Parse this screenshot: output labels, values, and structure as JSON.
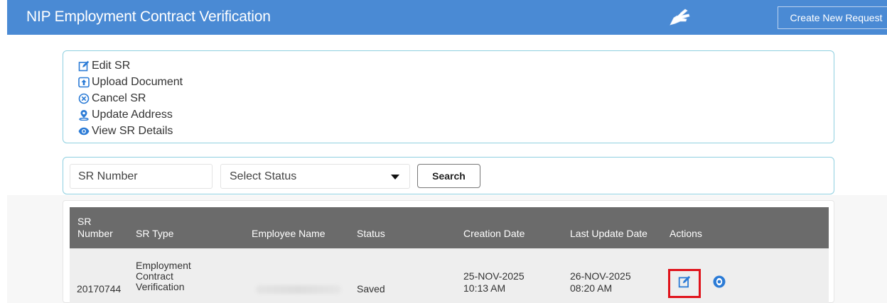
{
  "header": {
    "title": "NIP Employment Contract Verification",
    "create_button_label": "Create New Request",
    "hand_icon": "pointing-hand-icon",
    "bg_color": "#4a8ad4"
  },
  "legend": {
    "items": [
      {
        "label": "Edit SR",
        "icon": "edit-icon"
      },
      {
        "label": "Upload Document",
        "icon": "upload-icon"
      },
      {
        "label": "Cancel SR",
        "icon": "cancel-circle-icon"
      },
      {
        "label": "Update Address",
        "icon": "location-pin-icon"
      },
      {
        "label": "View SR Details",
        "icon": "eye-icon"
      }
    ]
  },
  "search": {
    "sr_number_placeholder": "SR Number",
    "status_selected": "Select Status",
    "search_button_label": "Search"
  },
  "table": {
    "columns": [
      "SR\nNumber",
      "SR Type",
      "Employee Name",
      "Status",
      "Creation Date",
      "Last Update Date",
      "Actions"
    ],
    "rows": [
      {
        "sr_number": "20170744",
        "sr_type": "Employment\nContract\nVerification",
        "employee_name": "",
        "status": "Saved",
        "creation_date": "25-NOV-2025\n10:13 AM",
        "last_update_date": "26-NOV-2025\n08:20 AM",
        "actions": [
          "edit-icon",
          "eye-icon"
        ]
      }
    ],
    "header_color": "#6b6b6b",
    "highlight_color": "#e0121a"
  }
}
